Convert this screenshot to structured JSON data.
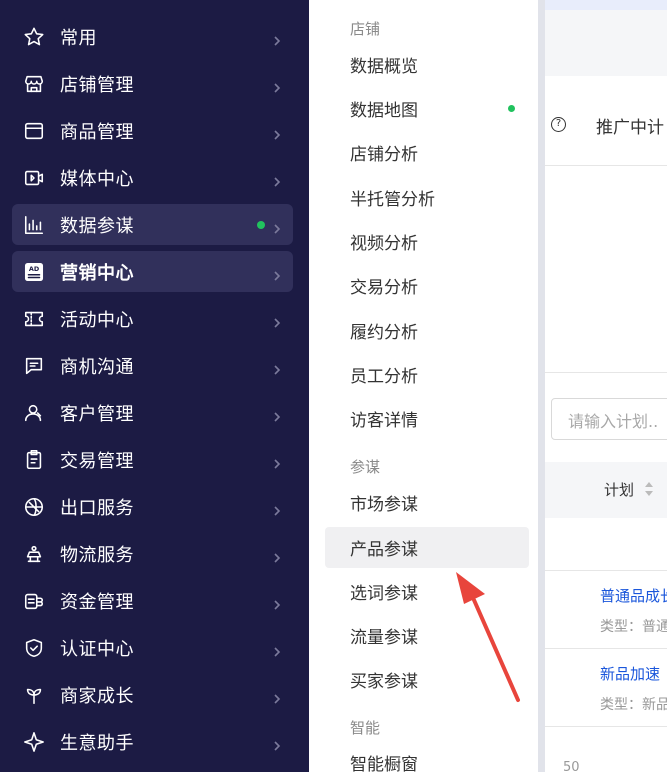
{
  "nav": {
    "items": [
      {
        "label": "常用",
        "icon": "star-icon"
      },
      {
        "label": "店铺管理",
        "icon": "store-icon"
      },
      {
        "label": "商品管理",
        "icon": "product-icon"
      },
      {
        "label": "媒体中心",
        "icon": "media-icon"
      },
      {
        "label": "数据参谋",
        "icon": "bar-chart-icon",
        "dot": "#21c25e"
      },
      {
        "label": "营销中心",
        "icon": "ad-icon",
        "active": true
      },
      {
        "label": "活动中心",
        "icon": "ticket-icon"
      },
      {
        "label": "商机沟通",
        "icon": "message-icon"
      },
      {
        "label": "客户管理",
        "icon": "customers-icon"
      },
      {
        "label": "交易管理",
        "icon": "clipboard-icon"
      },
      {
        "label": "出口服务",
        "icon": "globe-icon"
      },
      {
        "label": "物流服务",
        "icon": "truck-icon"
      },
      {
        "label": "资金管理",
        "icon": "coins-icon"
      },
      {
        "label": "认证中心",
        "icon": "shield-icon"
      },
      {
        "label": "商家成长",
        "icon": "sprout-icon"
      },
      {
        "label": "生意助手",
        "icon": "sparkle-icon"
      }
    ]
  },
  "submenu": {
    "groups": [
      {
        "title": "店铺",
        "items": [
          {
            "label": "数据概览"
          },
          {
            "label": "数据地图",
            "dot": "#21c25e"
          },
          {
            "label": "店铺分析"
          },
          {
            "label": "半托管分析"
          },
          {
            "label": "视频分析"
          },
          {
            "label": "交易分析"
          },
          {
            "label": "履约分析"
          },
          {
            "label": "员工分析"
          },
          {
            "label": "访客详情"
          }
        ]
      },
      {
        "title": "参谋",
        "items": [
          {
            "label": "市场参谋"
          },
          {
            "label": "产品参谋",
            "active": true
          },
          {
            "label": "选词参谋"
          },
          {
            "label": "流量参谋"
          },
          {
            "label": "买家参谋"
          }
        ]
      },
      {
        "title": "智能",
        "items": [
          {
            "label": "智能橱窗"
          }
        ]
      }
    ]
  },
  "main": {
    "help_icon": "?",
    "title": "推广中计",
    "search_placeholder": "请输入计划..",
    "table_header": "计划",
    "rows": [
      {
        "name": "普通品成长",
        "type": "类型：普通"
      },
      {
        "name": "新品加速",
        "type": "类型：新品"
      }
    ],
    "bottom_text": "50"
  },
  "colors": {
    "nav_bg": "#1c1b44",
    "nav_highlight": "#31305b",
    "arrow": "#e8453c",
    "link": "#1a56db"
  }
}
